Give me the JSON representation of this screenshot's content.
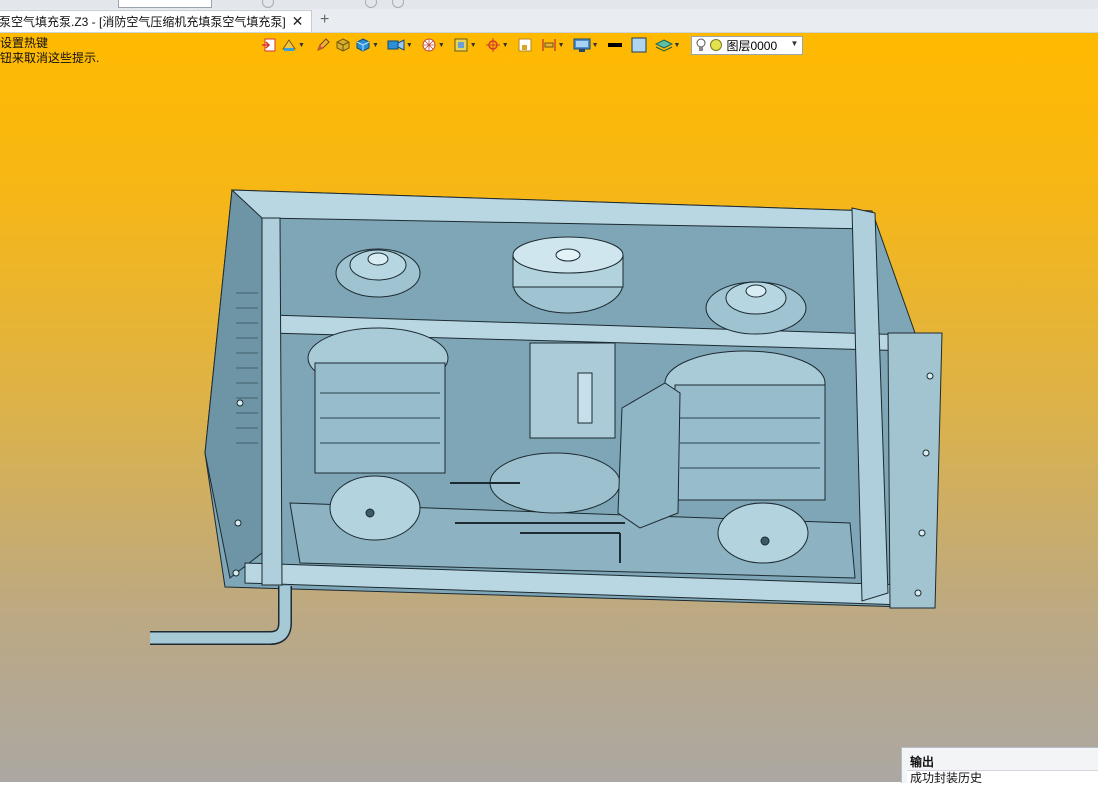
{
  "window": {
    "tab_title": "泵空气填充泵.Z3 - [消防空气压缩机充填泵空气填充泵]",
    "close_glyph": "✕",
    "new_tab_glyph": "+"
  },
  "hint": {
    "line1": "设置热键",
    "line2": "钮来取消这些提示."
  },
  "toolbar": {
    "layer": {
      "value": "图层0000",
      "icons": [
        "lightbulb-icon",
        "circle-status-icon"
      ]
    },
    "icons": [
      "exit-sketch-icon",
      "render-mode-icon",
      "pen-icon",
      "cube-shaded-icon",
      "cube-view-icon",
      "camera-icon",
      "sphere-grid-icon",
      "frame-icon",
      "target-icon",
      "square-outline-icon",
      "align-icon",
      "display-icon",
      "line-color-icon",
      "fill-color-icon",
      "layer-stack-icon"
    ]
  },
  "output_panel": {
    "title": "输出",
    "first_line": "成功封装历史"
  },
  "colors": {
    "viewport_top": "#ffba00",
    "viewport_bottom": "#aba7a2",
    "model_fill": "#9fc3d0",
    "model_edge": "#1c2a31"
  }
}
